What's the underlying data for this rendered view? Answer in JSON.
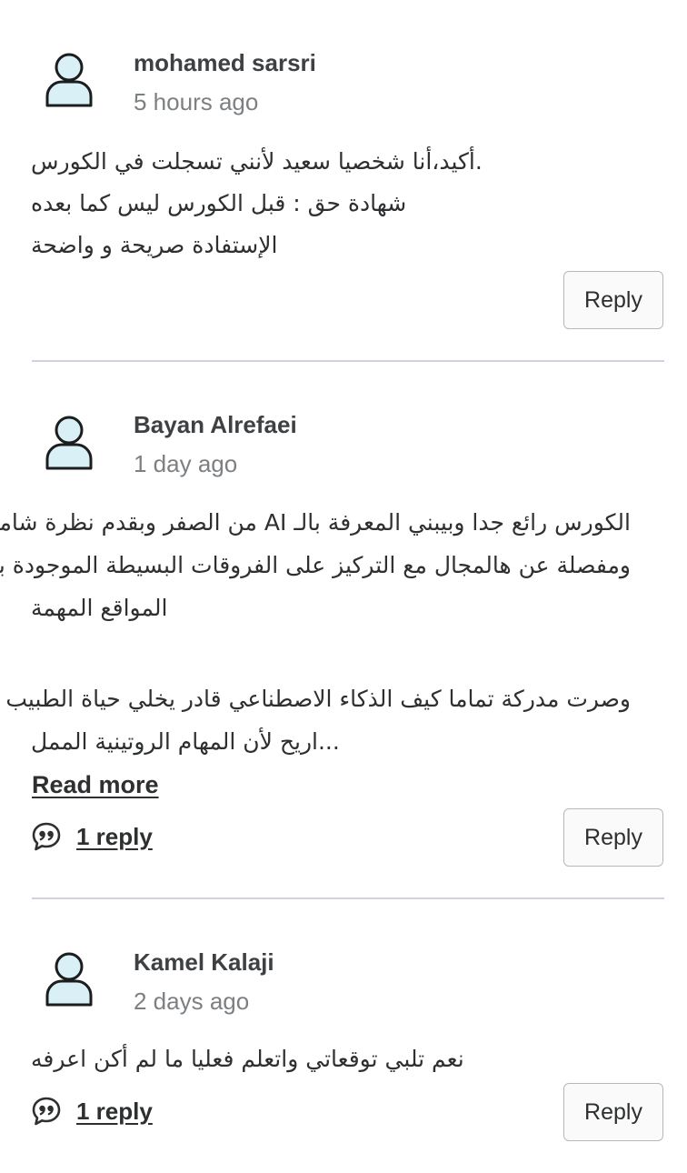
{
  "reviews": [
    {
      "author": "mohamed sarsri",
      "time": "5 hours ago",
      "lines": [
        ".أكيد،أنا شخصيا سعيد لأنني تسجلت في الكورس",
        "شهادة حق : قبل الكورس ليس كما بعده",
        "الإستفادة صريحة و واضحة"
      ],
      "reply_label": "Reply"
    },
    {
      "author": "Bayan Alrefaei",
      "time": "1 day ago",
      "lines": [
        "الكورس رائع جدا وبيبني المعرفة بالـ AI من الصفر وبقدم نظرة شاملة",
        "ومفصلة عن هالمجال مع التركيز على الفروقات البسيطة الموجودة بين",
        "المواقع المهمة",
        "وصرت مدركة تماما كيف الذكاء الاصطناعي قادر يخلي حياة الطبيب",
        "...اريح لأن المهام الروتينية الممل"
      ],
      "read_more": "Read more",
      "replies_label": "1 reply",
      "reply_label": "Reply"
    },
    {
      "author": "Kamel Kalaji",
      "time": "2 days ago",
      "lines": [
        "نعم تلبي توقعاتي واتعلم فعليا ما لم أكن اعرفه"
      ],
      "replies_label": "1 reply",
      "reply_label": "Reply"
    }
  ],
  "icons": {
    "avatar": "user-avatar-icon",
    "replies": "speech-bubble-quote-icon"
  },
  "colors": {
    "avatar_fill": "#d9f1f6",
    "avatar_stroke": "#1c1d1f",
    "divider": "#d1d2e0",
    "muted_text": "#7d8083"
  }
}
